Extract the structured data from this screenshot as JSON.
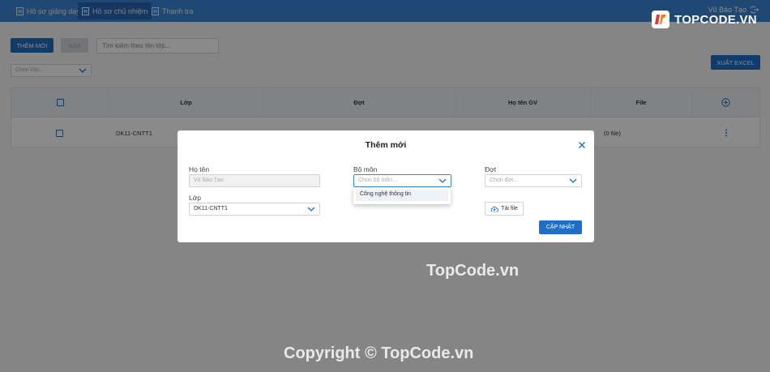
{
  "nav": {
    "tabs": [
      {
        "label": "Hồ sơ giảng dạy",
        "active": false
      },
      {
        "label": "Hồ sơ chủ nhiệm",
        "active": true
      },
      {
        "label": "Thanh tra",
        "active": false
      }
    ],
    "user_name": "Vũ Bảo Tạo"
  },
  "toolbar": {
    "add_label": "Thêm mới",
    "delete_label": "Xóa",
    "search_placeholder": "Tìm kiếm theo tên lớp...",
    "class_filter_placeholder": "Chọn lớp...",
    "export_label": "Xuất Excel"
  },
  "table": {
    "headers": [
      "",
      "Lớp",
      "Đợt",
      "Họ tên GV",
      "File",
      ""
    ],
    "rows": [
      {
        "class": "DK11-CNTT1",
        "file": "(0 file)"
      }
    ]
  },
  "modal": {
    "title": "Thêm mới",
    "name_label": "Họ tên",
    "name_value": "Vũ Bảo Tạo",
    "dept_label": "Bộ môn",
    "dept_placeholder": "Chọn bộ môn...",
    "dept_options": [
      "Công nghệ thông tin"
    ],
    "period_label": "Đợt",
    "period_placeholder": "Chọn đợt...",
    "class_label": "Lớp",
    "class_value": "DK11-CNTT1",
    "upload_label": "Tải file",
    "submit_label": "Cập nhật"
  },
  "watermark": {
    "logo_text": "TOPCODE.VN",
    "center_text": "TopCode.vn",
    "copyright_text": "Copyright © TopCode.vn"
  },
  "colors": {
    "header_bg": "#3a86d6",
    "primary": "#1f6fc7",
    "brand_orange": "#f27d1c"
  }
}
